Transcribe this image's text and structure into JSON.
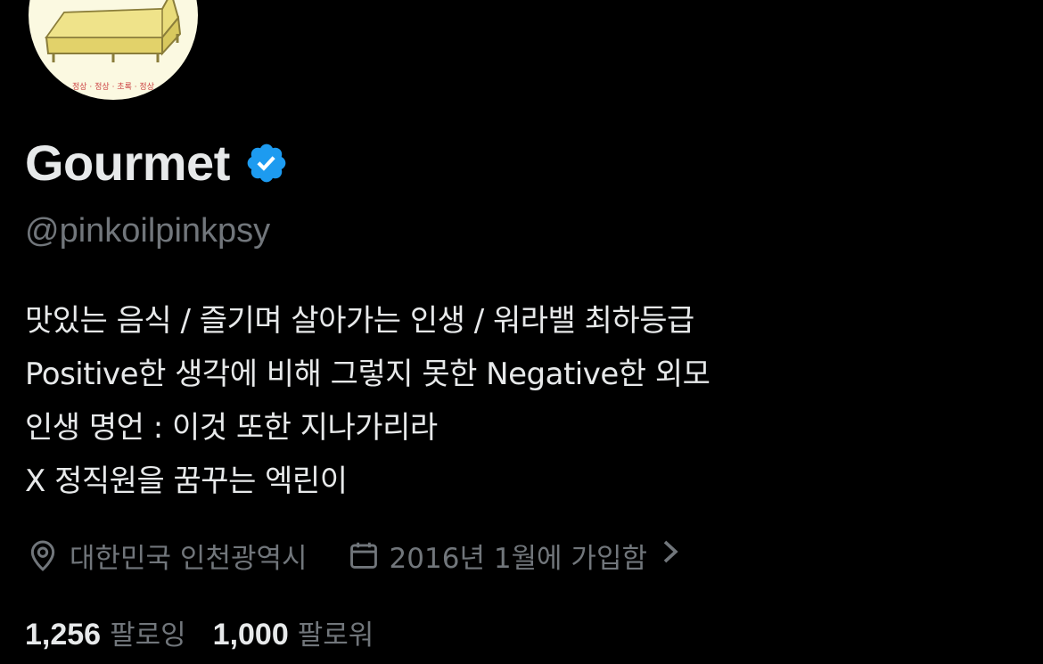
{
  "profile": {
    "avatar_caption": "정상 · 정상 · 초록 · 정상",
    "display_name": "Gourmet",
    "verified_icon": "verified-badge-icon",
    "handle": "@pinkoilpinkpsy",
    "bio_lines": [
      "맛있는 음식 / 즐기며 살아가는 인생 / 워라밸 최하등급",
      "Positive한 생각에 비해 그렇지 못한 Negative한 외모",
      "인생 명언 : 이것 또한 지나가리라",
      "X 정직원을 꿈꾸는 엑린이"
    ],
    "location": "대한민국 인천광역시",
    "joined": "2016년 1월에 가입함",
    "following_count": "1,256",
    "following_label": "팔로잉",
    "followers_count": "1,000",
    "followers_label": "팔로워"
  },
  "colors": {
    "background": "#000000",
    "primary_text": "#e7e9ea",
    "secondary_text": "#71767b",
    "verified_blue": "#1d9bf0",
    "avatar_bg": "#fbf9e1",
    "avatar_sofa": "#e9dc7a"
  }
}
